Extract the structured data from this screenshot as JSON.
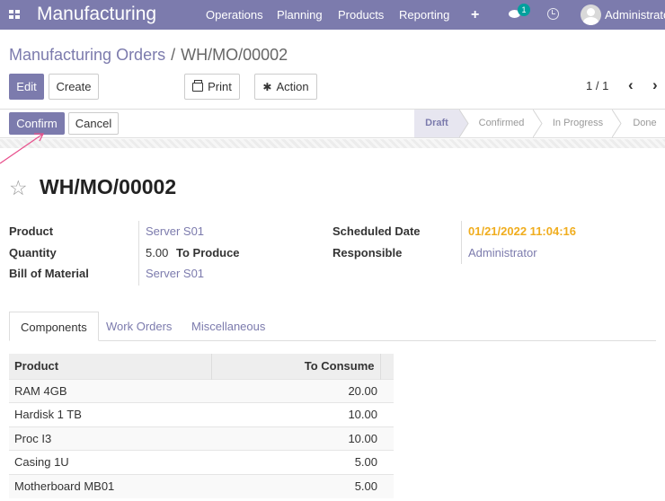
{
  "topbar": {
    "app_name": "Manufacturing",
    "menu": [
      "Operations",
      "Planning",
      "Products",
      "Reporting"
    ],
    "messages_badge": "1",
    "user": "Administrator"
  },
  "breadcrumb": {
    "parent": "Manufacturing Orders",
    "current": "WH/MO/00002"
  },
  "toolbar": {
    "edit_label": "Edit",
    "create_label": "Create",
    "print_label": "Print",
    "action_label": "Action",
    "pager": "1 / 1"
  },
  "statusbar": {
    "confirm_label": "Confirm",
    "cancel_label": "Cancel",
    "stages": [
      "Draft",
      "Confirmed",
      "In Progress",
      "Done"
    ],
    "active_stage": "Draft"
  },
  "record": {
    "title": "WH/MO/00002",
    "fields": {
      "product_label": "Product",
      "product_value": "Server S01",
      "quantity_label": "Quantity",
      "quantity_value": "5.00",
      "quantity_suffix": "To Produce",
      "bom_label": "Bill of Material",
      "bom_value": "Server S01",
      "scheduled_label": "Scheduled Date",
      "scheduled_value": "01/21/2022 11:04:16",
      "responsible_label": "Responsible",
      "responsible_value": "Administrator"
    }
  },
  "tabs": [
    "Components",
    "Work Orders",
    "Miscellaneous"
  ],
  "components": {
    "headers": [
      "Product",
      "To Consume"
    ],
    "rows": [
      {
        "product": "RAM 4GB",
        "qty": "20.00"
      },
      {
        "product": "Hardisk 1 TB",
        "qty": "10.00"
      },
      {
        "product": "Proc I3",
        "qty": "10.00"
      },
      {
        "product": "Casing 1U",
        "qty": "5.00"
      },
      {
        "product": "Motherboard MB01",
        "qty": "5.00"
      }
    ]
  },
  "colors": {
    "brand": "#7c7bad",
    "warning": "#f0ad1e",
    "annotation_arrow": "#e8508c"
  },
  "icons": [
    "apps-icon",
    "plus-icon",
    "chat-icon",
    "clock-icon",
    "avatar",
    "printer-icon",
    "gear-icon",
    "chevron-left-icon",
    "chevron-right-icon",
    "star-icon"
  ]
}
